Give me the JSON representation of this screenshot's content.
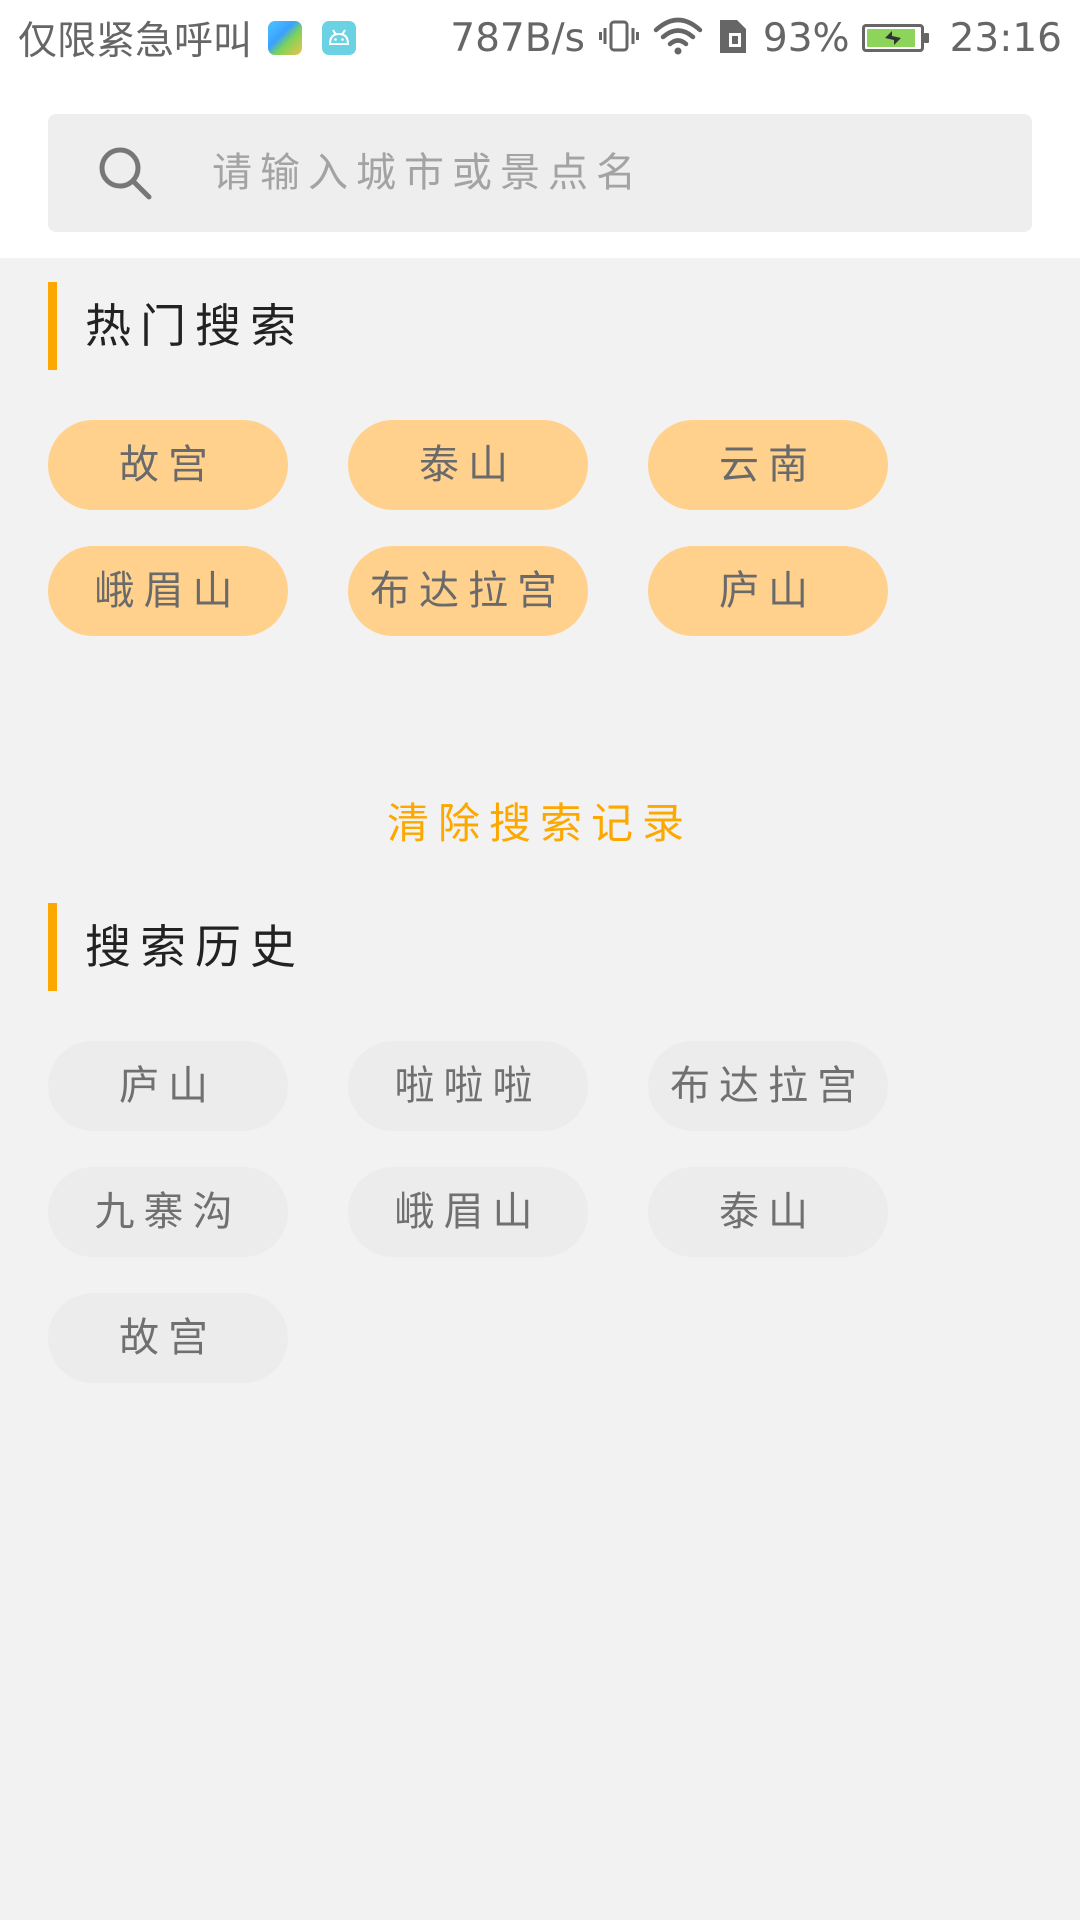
{
  "status_bar": {
    "carrier": "仅限紧急呼叫",
    "net_speed": "787B/s",
    "battery_percent": "93%",
    "battery_level": 0.93,
    "time": "23:16",
    "icons": [
      "maps-app-icon",
      "android-app-icon",
      "vibrate-icon",
      "wifi-icon",
      "sim-icon",
      "battery-charging-icon"
    ],
    "colors": {
      "text": "#666666",
      "battery_fill": "#8cd45a"
    }
  },
  "search": {
    "placeholder": "请输入城市或景点名",
    "value": "",
    "icon": "search-icon"
  },
  "hot_search": {
    "title": "热门搜索",
    "tags": [
      "故宫",
      "泰山",
      "云南",
      "峨眉山",
      "布达拉宫",
      "庐山"
    ]
  },
  "clear_history_label": "清除搜索记录",
  "search_history": {
    "title": "搜索历史",
    "tags": [
      "庐山",
      "啦啦啦",
      "布达拉宫",
      "九寨沟",
      "峨眉山",
      "泰山",
      "故宫"
    ]
  },
  "colors": {
    "accent": "#fca800",
    "hot_tag_bg": "#ffd18c",
    "history_tag_bg": "#ececec",
    "page_bg": "#f2f2f2"
  }
}
